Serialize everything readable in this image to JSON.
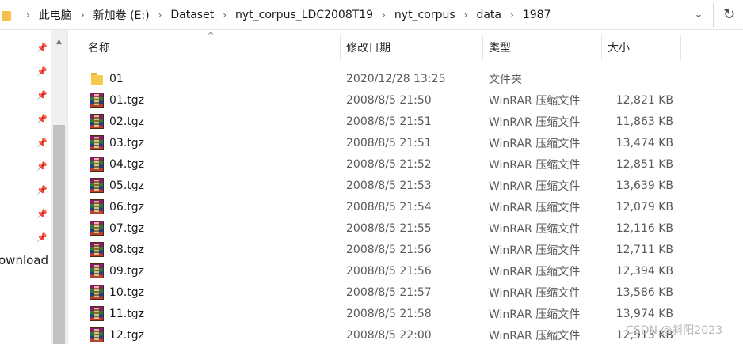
{
  "address_bar": {
    "crumbs": [
      "此电脑",
      "新加卷 (E:)",
      "Dataset",
      "nyt_corpus_LDC2008T19",
      "nyt_corpus",
      "data",
      "1987"
    ],
    "separator": "›",
    "dropdown_glyph": "⌄",
    "refresh_glyph": "↻"
  },
  "nav_pane": {
    "pin_glyph": "📌",
    "partial_item_label": "ownload",
    "scroll_up_glyph": "▲"
  },
  "columns": {
    "name": "名称",
    "date": "修改日期",
    "type": "类型",
    "size": "大小",
    "sort_glyph": "^"
  },
  "files": [
    {
      "name": "01",
      "date": "2020/12/28 13:25",
      "type": "文件夹",
      "size": "",
      "icon": "folder-icon"
    },
    {
      "name": "01.tgz",
      "date": "2008/8/5 21:50",
      "type": "WinRAR 压缩文件",
      "size": "12,821 KB",
      "icon": "winrar-archive-icon"
    },
    {
      "name": "02.tgz",
      "date": "2008/8/5 21:51",
      "type": "WinRAR 压缩文件",
      "size": "11,863 KB",
      "icon": "winrar-archive-icon"
    },
    {
      "name": "03.tgz",
      "date": "2008/8/5 21:51",
      "type": "WinRAR 压缩文件",
      "size": "13,474 KB",
      "icon": "winrar-archive-icon"
    },
    {
      "name": "04.tgz",
      "date": "2008/8/5 21:52",
      "type": "WinRAR 压缩文件",
      "size": "12,851 KB",
      "icon": "winrar-archive-icon"
    },
    {
      "name": "05.tgz",
      "date": "2008/8/5 21:53",
      "type": "WinRAR 压缩文件",
      "size": "13,639 KB",
      "icon": "winrar-archive-icon"
    },
    {
      "name": "06.tgz",
      "date": "2008/8/5 21:54",
      "type": "WinRAR 压缩文件",
      "size": "12,079 KB",
      "icon": "winrar-archive-icon"
    },
    {
      "name": "07.tgz",
      "date": "2008/8/5 21:55",
      "type": "WinRAR 压缩文件",
      "size": "12,116 KB",
      "icon": "winrar-archive-icon"
    },
    {
      "name": "08.tgz",
      "date": "2008/8/5 21:56",
      "type": "WinRAR 压缩文件",
      "size": "12,711 KB",
      "icon": "winrar-archive-icon"
    },
    {
      "name": "09.tgz",
      "date": "2008/8/5 21:56",
      "type": "WinRAR 压缩文件",
      "size": "12,394 KB",
      "icon": "winrar-archive-icon"
    },
    {
      "name": "10.tgz",
      "date": "2008/8/5 21:57",
      "type": "WinRAR 压缩文件",
      "size": "13,586 KB",
      "icon": "winrar-archive-icon"
    },
    {
      "name": "11.tgz",
      "date": "2008/8/5 21:58",
      "type": "WinRAR 压缩文件",
      "size": "13,974 KB",
      "icon": "winrar-archive-icon"
    },
    {
      "name": "12.tgz",
      "date": "2008/8/5 22:00",
      "type": "WinRAR 压缩文件",
      "size": "12,913 KB",
      "icon": "winrar-archive-icon"
    }
  ],
  "watermark": "CSDN @斜阳2023"
}
